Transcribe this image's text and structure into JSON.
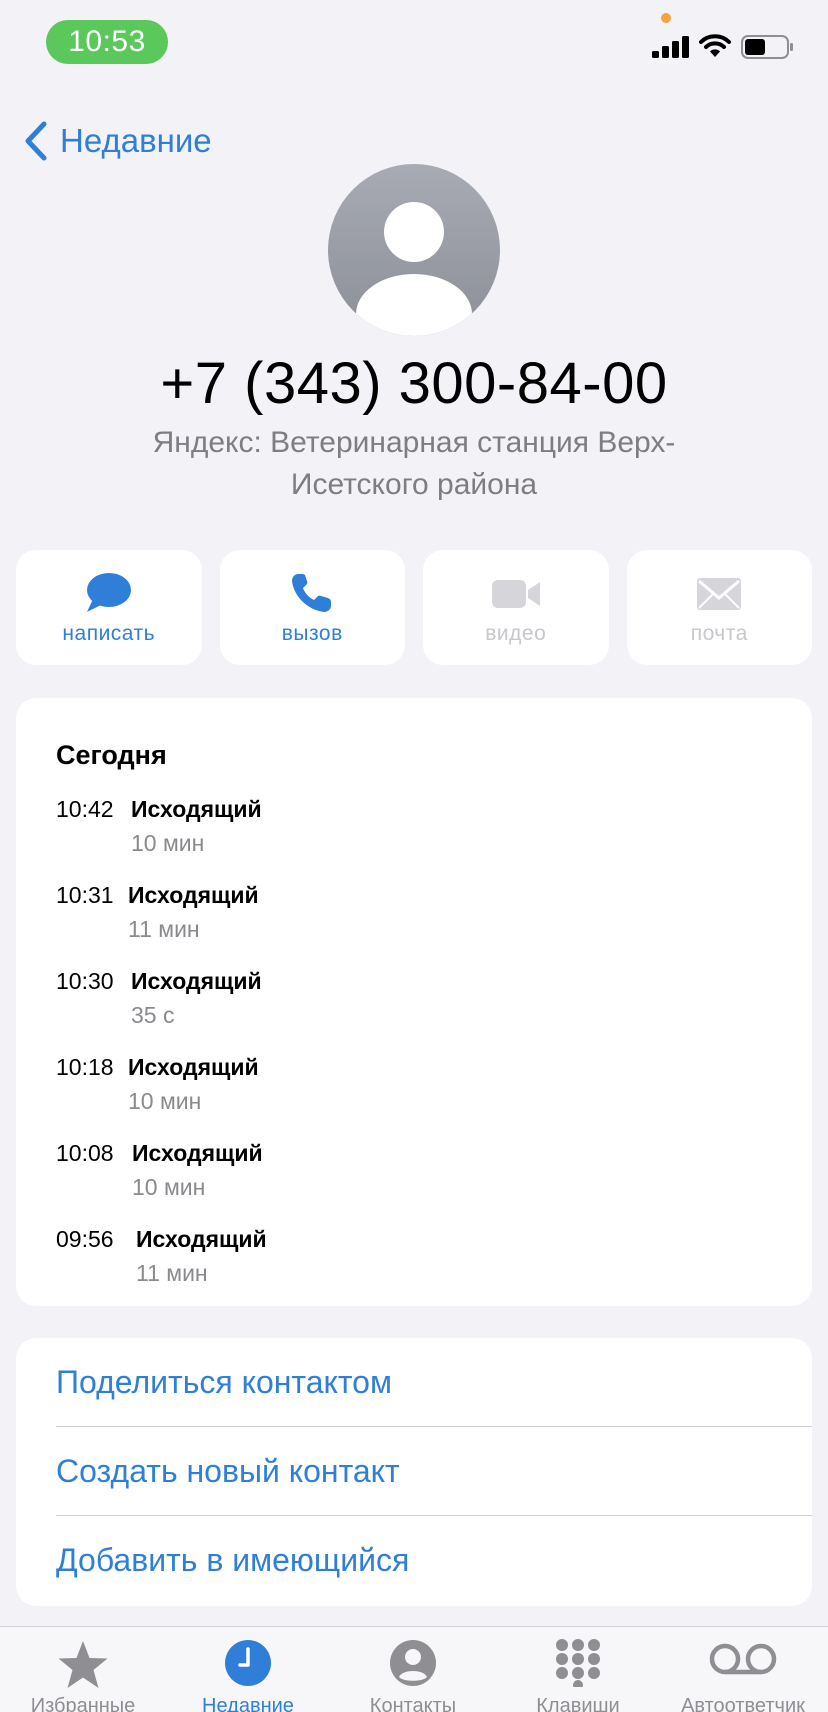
{
  "status_bar": {
    "time": "10:53",
    "colors": {
      "pill": "#5ac85a",
      "privacy_dot": "#f5a33a"
    }
  },
  "nav": {
    "back_label": "Недавние"
  },
  "contact": {
    "phone": "+7 (343) 300-84-00",
    "subtitle_line1": "Яндекс: Ветеринарная станция Верх-",
    "subtitle_line2": "Исетского района"
  },
  "actions": [
    {
      "label": "написать",
      "icon": "message-bubble-icon",
      "enabled": true
    },
    {
      "label": "вызов",
      "icon": "phone-icon",
      "enabled": true
    },
    {
      "label": "видео",
      "icon": "video-camera-icon",
      "enabled": false
    },
    {
      "label": "почта",
      "icon": "mail-envelope-icon",
      "enabled": false
    }
  ],
  "history": {
    "title": "Сегодня",
    "calls": [
      {
        "time": "10:42",
        "type": "Исходящий",
        "duration": "10 мин"
      },
      {
        "time": "10:31",
        "type": "Исходящий",
        "duration": "11 мин"
      },
      {
        "time": "10:30",
        "type": "Исходящий",
        "duration": "35 с"
      },
      {
        "time": "10:18",
        "type": "Исходящий",
        "duration": "10 мин"
      },
      {
        "time": "10:08",
        "type": "Исходящий",
        "duration": "10 мин"
      },
      {
        "time": "09:56",
        "type": "Исходящий",
        "duration": "11 мин"
      }
    ]
  },
  "options": [
    {
      "label": "Поделиться контактом"
    },
    {
      "label": "Создать новый контакт"
    },
    {
      "label": "Добавить в имеющийся"
    }
  ],
  "tabbar": {
    "selected": "Недавние",
    "tabs": [
      {
        "label": "Избранные",
        "icon": "star-icon"
      },
      {
        "label": "Недавние",
        "icon": "clock-icon"
      },
      {
        "label": "Контакты",
        "icon": "person-circle-icon"
      },
      {
        "label": "Клавиши",
        "icon": "keypad-icon"
      },
      {
        "label": "Автоответчик",
        "icon": "voicemail-icon"
      }
    ]
  },
  "colors": {
    "accent": "#2f7fd9",
    "background": "#f2f2f7",
    "disabled": "#c7c7cc",
    "secondary_text": "#8a8a8e"
  }
}
